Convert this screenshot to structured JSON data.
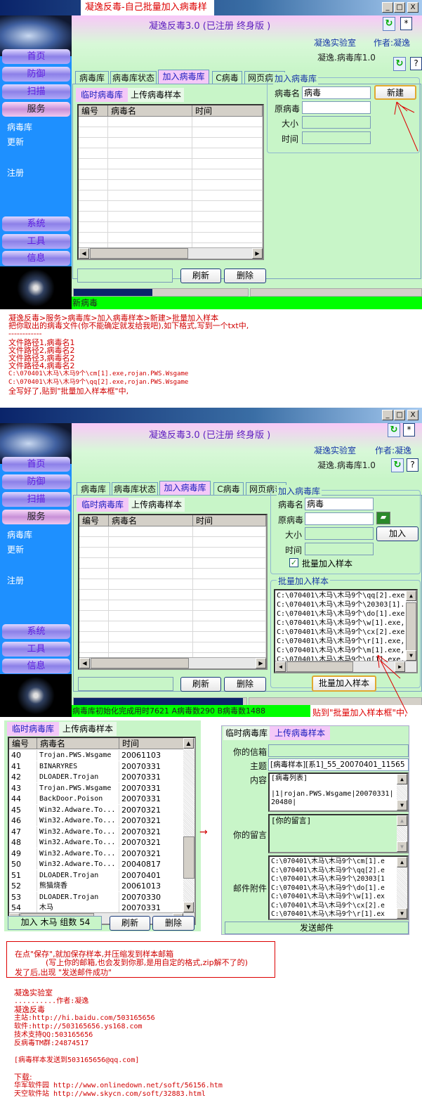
{
  "window1": {
    "title": "凝逸反毒-自己批量加入病毒样本",
    "window_controls": [
      "_",
      "□",
      "X"
    ],
    "header": {
      "app": "凝逸反毒3.0  (已注册 终身版 )",
      "lab": "凝逸实验室",
      "author": "作者:凝逸",
      "db": "凝逸.病毒库1.0",
      "star_btn": "*",
      "help_btn": "?"
    },
    "nav": [
      "首页",
      "防御",
      "扫描",
      "服务",
      "系统",
      "工具",
      "信息"
    ],
    "side_items": [
      "病毒库",
      "更新",
      "注册"
    ],
    "tabs": [
      "病毒库",
      "病毒库状态",
      "加入病毒库",
      "C病毒",
      "网页病毒"
    ],
    "subtabs": [
      "临时病毒库",
      "上传病毒样本"
    ],
    "columns": [
      "编号",
      "病毒名",
      "时间"
    ],
    "buttons": {
      "refresh": "刷新",
      "delete": "删除",
      "new": "新建"
    },
    "group": {
      "title": "加入病毒库",
      "name_label": "病毒名",
      "name_value": "病毒",
      "orig_label": "原病毒",
      "size_label": "大小",
      "time_label": "时间"
    },
    "progress": 0.45,
    "status": "新病毒"
  },
  "instructions": [
    "凝逸反毒>服务>病毒库>加入病毒样本>新建>批量加入样本",
    "把你取出的病毒文件(你不能确定就发给我吧),如下格式,写到一个txt中,",
    "------------",
    "文件路径1,病毒名1",
    "文件路径2,病毒名2",
    "文件路径3,病毒名2",
    "文件路径4,病毒名2",
    "C:\\070401\\木马\\木马9个\\cm[1].exe,rojan.PWS.Wsgame",
    "C:\\070401\\木马\\木马9个\\qq[2].exe,rojan.PWS.Wsgame",
    "全写好了,贴到\"批量加入样本框\"中,"
  ],
  "window2": {
    "window_controls": [
      "_",
      "□",
      "X"
    ],
    "header": {
      "app": "凝逸反毒3.0  (已注册 终身版 )",
      "lab": "凝逸实验室",
      "author": "作者:凝逸",
      "db": "凝逸.病毒库1.0",
      "star_btn": "*",
      "help_btn": "?"
    },
    "nav": [
      "首页",
      "防御",
      "扫描",
      "服务",
      "系统",
      "工具",
      "信息"
    ],
    "side_items": [
      "病毒库",
      "更新",
      "注册"
    ],
    "tabs": [
      "病毒库",
      "病毒库状态",
      "加入病毒库",
      "C病毒",
      "网页病毒"
    ],
    "subtabs": [
      "临时病毒库",
      "上传病毒样本"
    ],
    "columns": [
      "编号",
      "病毒名",
      "时间"
    ],
    "buttons": {
      "refresh": "刷新",
      "delete": "删除",
      "add": "加入",
      "batch_add": "批量加入样本"
    },
    "group": {
      "title": "加入病毒库",
      "name_label": "病毒名",
      "name_value": "病毒",
      "orig_label": "原病毒",
      "size_label": "大小",
      "time_label": "时间",
      "checkbox_label": "批量加入样本",
      "checkbox_checked": true
    },
    "batch_group_title": "批量加入样本",
    "batch_lines": [
      "C:\\070401\\木马\\木马9个\\qq[2].exe",
      "C:\\070401\\木马\\木马9个\\20303[1].",
      "C:\\070401\\木马\\木马9个\\do[1].exe",
      "C:\\070401\\木马\\木马9个\\w[1].exe,",
      "C:\\070401\\木马\\木马9个\\cx[2].exe",
      "C:\\070401\\木马\\木马9个\\r[1].exe,",
      "C:\\070401\\木马\\木马9个\\m[1].exe,",
      "C:\\070401\\木马\\木马9个\\q[1].exe,"
    ],
    "progress": 0.98,
    "status": "病毒库初始化完成用时7621 A病毒数290 B病毒数1488",
    "note": "贴到\"批量加入样本框\"中,"
  },
  "temp_db": {
    "subtabs": [
      "临时病毒库",
      "上传病毒样本"
    ],
    "columns": [
      "编号",
      "病毒名",
      "时间"
    ],
    "rows": [
      [
        "40",
        "Trojan.PWS.Wsgame",
        "20061103"
      ],
      [
        "41",
        "BINARYRES",
        "20070331"
      ],
      [
        "42",
        "DLOADER.Trojan",
        "20070331"
      ],
      [
        "43",
        "Trojan.PWS.Wsgame",
        "20070331"
      ],
      [
        "44",
        "BackDoor.Poison",
        "20070331"
      ],
      [
        "45",
        "Win32.Adware.To...",
        "20070321"
      ],
      [
        "46",
        "Win32.Adware.To...",
        "20070321"
      ],
      [
        "47",
        "Win32.Adware.To...",
        "20070321"
      ],
      [
        "48",
        "Win32.Adware.To...",
        "20070321"
      ],
      [
        "49",
        "Win32.Adware.To...",
        "20070321"
      ],
      [
        "50",
        "Win32.Adware.To...",
        "20040817"
      ],
      [
        "51",
        "DLOADER.Trojan",
        "20070401"
      ],
      [
        "52",
        "熊猫烧香",
        "20061013"
      ],
      [
        "53",
        "DLOADER.Trojan",
        "20070330"
      ],
      [
        "54",
        "木马",
        "20070331"
      ]
    ],
    "summary": "加入 木马 组数 54",
    "refresh": "刷新",
    "delete": "删除"
  },
  "upload": {
    "subtabs": [
      "临时病毒库",
      "上传病毒样本"
    ],
    "email_label": "你的信箱",
    "email_value": "",
    "subject_label": "主题",
    "subject_value": "[病毒样本][系1]_55_20070401_11565",
    "content_label": "内容",
    "content_lines": [
      "[病毒列表]",
      "",
      "|1|rojan.PWS.Wsgame|20070331|",
      "20480|"
    ],
    "message_label": "你的留言",
    "message_value": "[你的留言]",
    "attach_label": "邮件附件",
    "attach_lines": [
      "C:\\070401\\木马\\木马9个\\cm[1].e",
      "C:\\070401\\木马\\木马9个\\qq[2].e",
      "C:\\070401\\木马\\木马9个\\20303[1",
      "C:\\070401\\木马\\木马9个\\do[1].e",
      "C:\\070401\\木马\\木马9个\\w[1].ex",
      "C:\\070401\\木马\\木马9个\\cx[2].e",
      "C:\\070401\\木马\\木马9个\\r[1].ex"
    ],
    "send": "发送邮件"
  },
  "callout": [
    "在点\"保存\",就加保存样本,并压缩发到样本邮箱",
    "(写上你的邮箱,也会发到你那,是用自定的格式,zip解不了的)",
    "发了后,出现 \"发送邮件成功\""
  ],
  "footer": [
    "凝逸实验室",
    "..........作者:凝逸",
    "凝逸反毒",
    "主站:http://hi.baidu.com/503165656",
    "软件:http://503165656.ys168.com",
    "技术支持QQ:503165656",
    "反病毒TM群:24874517",
    "",
    "[病毒样本发送到503165656@qq.com]",
    "",
    "下载:",
    "华军软件园 http://www.onlinedown.net/soft/56156.htm",
    "天空软件站 http://www.skycn.com/soft/32883.html"
  ],
  "colors": {
    "panel": "#c8f5c8",
    "sidebar": "#1e90ff",
    "status": "#00ff00",
    "annotation": "#d00000"
  }
}
